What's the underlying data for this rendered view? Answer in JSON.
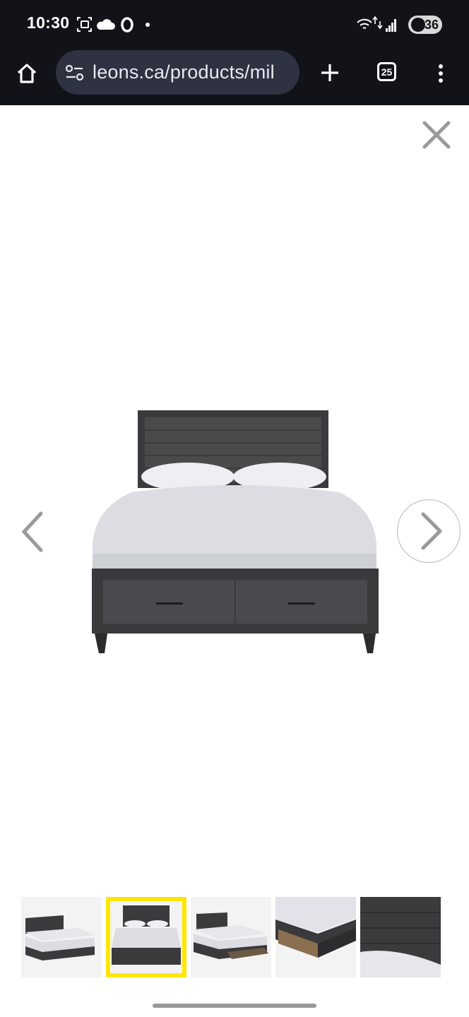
{
  "status_bar": {
    "time": "10:30",
    "battery": "36",
    "left_icons": [
      "screenshot-icon",
      "cloud-icon",
      "opera-icon",
      "dot-icon"
    ],
    "right_icons": [
      "wifi-icon",
      "signal-icon",
      "battery-icon"
    ]
  },
  "browser": {
    "url": "leons.ca/products/mil",
    "tab_count": "25",
    "icons": [
      "home-icon",
      "site-settings-icon",
      "new-tab-icon",
      "tab-switcher-icon",
      "more-menu-icon"
    ]
  },
  "viewer": {
    "icons": [
      "close-icon",
      "chevron-left-icon",
      "chevron-right-icon"
    ],
    "thumbnails": [
      {
        "view": "angled bed",
        "selected": false
      },
      {
        "view": "front bed",
        "selected": true
      },
      {
        "view": "bed with open drawer",
        "selected": false
      },
      {
        "view": "drawer close-up",
        "selected": false
      },
      {
        "view": "headboard close-up",
        "selected": false
      }
    ],
    "colors": {
      "selected_border": "#ffe600",
      "bar_background": "#111318",
      "url_field": "#2e3241"
    }
  }
}
